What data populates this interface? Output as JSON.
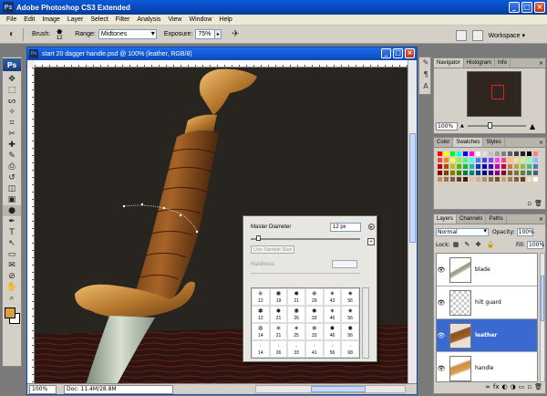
{
  "app": {
    "title": "Adobe Photoshop CS3 Extended",
    "badge": "Ps",
    "window_buttons": [
      "_",
      "□",
      "×"
    ]
  },
  "menu": [
    "File",
    "Edit",
    "Image",
    "Layer",
    "Select",
    "Filter",
    "Analysis",
    "View",
    "Window",
    "Help"
  ],
  "options": {
    "brush_label": "Brush:",
    "brush_size": "12",
    "range_label": "Range:",
    "range_value": "Midtones",
    "exposure_label": "Exposure:",
    "exposure_value": "75%",
    "workspace_label": "Workspace ▾"
  },
  "toolbox": {
    "logo": "Ps",
    "tools": [
      "move-icon",
      "marquee-icon",
      "lasso-icon",
      "magic-wand-icon",
      "crop-icon",
      "slice-icon",
      "healing-icon",
      "brush-icon",
      "stamp-icon",
      "history-brush-icon",
      "eraser-icon",
      "gradient-icon",
      "dodge-icon",
      "pen-icon",
      "type-icon",
      "path-select-icon",
      "shape-icon",
      "notes-icon",
      "eyedropper-icon",
      "hand-icon",
      "zoom-icon"
    ],
    "tool_glyphs": [
      "✥",
      "⬚",
      "ᔕ",
      "✧",
      "⌗",
      "✂",
      "✚",
      "✎",
      "⎙",
      "↺",
      "◫",
      "▣",
      "●",
      "✒",
      "T",
      "↖",
      "▭",
      "✉",
      "⊘",
      "✋",
      "⌕"
    ],
    "active_tool": 12,
    "fg_color": "#d8a040",
    "bg_color": "#ffffff"
  },
  "document": {
    "title": "start 20 dagger handle.psd @ 100% (leather, RGB/8)",
    "badge": "Ps",
    "zoom": "100%",
    "doc_info": "Doc: 11.4M/28.8M"
  },
  "brush_popup": {
    "master_diameter_label": "Master Diameter",
    "master_diameter_value": "12 px",
    "use_sample_label": "Use Sample Size",
    "hardness_label": "Hardness:",
    "menu_glyph": "▸",
    "save_glyph": "▪",
    "brushes": [
      {
        "glyph": "✳",
        "size": "12"
      },
      {
        "glyph": "✺",
        "size": "19"
      },
      {
        "glyph": "✹",
        "size": "21"
      },
      {
        "glyph": "✵",
        "size": "29"
      },
      {
        "glyph": "✶",
        "size": "43"
      },
      {
        "glyph": "✷",
        "size": "56"
      },
      {
        "glyph": "✱",
        "size": "12"
      },
      {
        "glyph": "✸",
        "size": "21"
      },
      {
        "glyph": "✺",
        "size": "26"
      },
      {
        "glyph": "✹",
        "size": "33"
      },
      {
        "glyph": "✶",
        "size": "46"
      },
      {
        "glyph": "✷",
        "size": "56"
      },
      {
        "glyph": "✲",
        "size": "14"
      },
      {
        "glyph": "✳",
        "size": "21"
      },
      {
        "glyph": "✴",
        "size": "25"
      },
      {
        "glyph": "✵",
        "size": "33"
      },
      {
        "glyph": "✸",
        "size": "46"
      },
      {
        "glyph": "✹",
        "size": "56"
      },
      {
        "glyph": "·",
        "size": "14"
      },
      {
        "glyph": "·",
        "size": "26"
      },
      {
        "glyph": "·",
        "size": "33"
      },
      {
        "glyph": "·",
        "size": "41"
      },
      {
        "glyph": "·",
        "size": "56"
      },
      {
        "glyph": "·",
        "size": "68"
      }
    ]
  },
  "navigator": {
    "tabs": [
      "Navigator",
      "Histogram",
      "Info"
    ],
    "zoom": "100%",
    "zoom_out": "▲",
    "zoom_in": "▲",
    "close": "×"
  },
  "swatches": {
    "tabs": [
      "Color",
      "Swatches",
      "Styles"
    ],
    "colors": [
      "#ff0000",
      "#ffff00",
      "#00ff00",
      "#00ffff",
      "#0000ff",
      "#ff00ff",
      "#ffffff",
      "#e0e0e0",
      "#c0c0c0",
      "#a0a0a0",
      "#808080",
      "#606060",
      "#404040",
      "#202020",
      "#000000",
      "#ff8080",
      "#ff4040",
      "#ff8000",
      "#ffff40",
      "#80ff40",
      "#40ff80",
      "#40ffff",
      "#4080ff",
      "#4040ff",
      "#8040ff",
      "#ff40ff",
      "#ff4080",
      "#ffc080",
      "#ffe080",
      "#c0ff80",
      "#80ffc0",
      "#80c0ff",
      "#c00000",
      "#c04000",
      "#c0c000",
      "#40c000",
      "#00c040",
      "#00c0c0",
      "#0040c0",
      "#0000c0",
      "#4000c0",
      "#c000c0",
      "#c00040",
      "#c08040",
      "#c0a040",
      "#80c040",
      "#40c080",
      "#4080c0",
      "#800000",
      "#804000",
      "#808000",
      "#408000",
      "#008040",
      "#008080",
      "#004080",
      "#000080",
      "#400080",
      "#800080",
      "#800040",
      "#806040",
      "#807040",
      "#608040",
      "#408060",
      "#406080",
      "#c09060",
      "#a07040",
      "#806040",
      "#604020",
      "#402010",
      "#e0c0a0",
      "#d0b090",
      "#b09070",
      "#907050",
      "#705030",
      "#c8a070",
      "#a88050",
      "#886030",
      "#684020",
      "#f0e0c0",
      "#ffffff"
    ],
    "footer": [
      "▫",
      "🗑"
    ]
  },
  "layers": {
    "tabs": [
      "Layers",
      "Channels",
      "Paths"
    ],
    "blend_mode": "Normal",
    "opacity_label": "Opacity:",
    "opacity_value": "100%",
    "lock_label": "Lock:",
    "lock_glyphs": "▦ ✎ ✥ 🔒",
    "fill_label": "Fill:",
    "fill_value": "100%",
    "items": [
      {
        "name": "blade",
        "thumb": "blade",
        "selected": false
      },
      {
        "name": "hilt guard",
        "thumb": "empty",
        "selected": false
      },
      {
        "name": "leather",
        "thumb": "leather",
        "selected": true
      },
      {
        "name": "handle",
        "thumb": "handle",
        "selected": false
      }
    ],
    "footer": [
      "∞",
      "fx",
      "◐",
      "◑",
      "▭",
      "▫",
      "🗑"
    ]
  }
}
